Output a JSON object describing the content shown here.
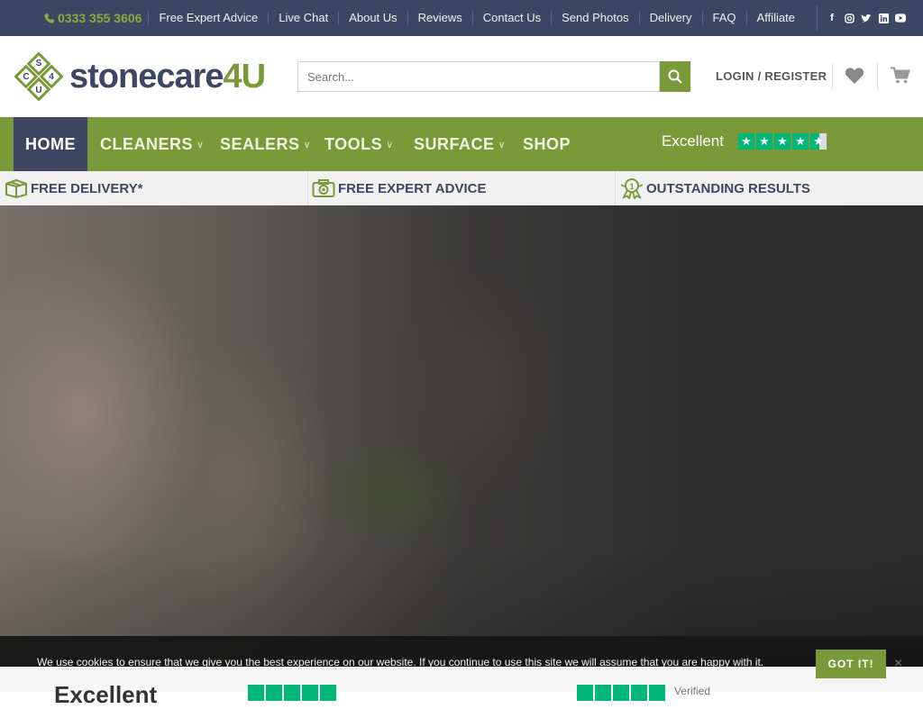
{
  "topbar": {
    "phone": "0333 355 3606",
    "links": [
      "Free Expert Advice",
      "Live Chat",
      "About Us",
      "Reviews",
      "Contact Us",
      "Send Photos",
      "Delivery",
      "FAQ",
      "Affiliate"
    ],
    "social_icons": [
      "facebook-icon",
      "instagram-icon",
      "twitter-icon",
      "linkedin-icon",
      "youtube-icon"
    ]
  },
  "header": {
    "logo": {
      "main": "stonecare",
      "suffix": "4U",
      "mark_letters": [
        "S",
        "C",
        "4",
        "U"
      ]
    },
    "search": {
      "placeholder": "Search..."
    },
    "login_label": "LOGIN / REGISTER"
  },
  "nav": {
    "items": [
      {
        "label": "HOME",
        "dropdown": false
      },
      {
        "label": "CLEANERS",
        "dropdown": true
      },
      {
        "label": "SEALERS",
        "dropdown": true
      },
      {
        "label": "TOOLS",
        "dropdown": true
      },
      {
        "label": "SURFACE",
        "dropdown": true
      },
      {
        "label": "SHOP",
        "dropdown": false
      }
    ],
    "trustpilot": {
      "label": "Excellent",
      "rating": 4.5,
      "max": 5
    }
  },
  "usp": {
    "items": [
      "FREE DELIVERY*",
      "FREE EXPERT ADVICE",
      "OUTSTANDING RESULTS"
    ]
  },
  "below": {
    "heading": "Excellent",
    "verified": "Verified"
  },
  "cookie": {
    "message": "We use cookies to ensure that we give you the best experience on our website. If you continue to use this site we will assume that you are happy with it.",
    "button": "GOT IT!",
    "close": "×"
  },
  "colors": {
    "navy": "#3d4663",
    "green": "#7a9a39",
    "trustpilot": "#00b67a"
  }
}
